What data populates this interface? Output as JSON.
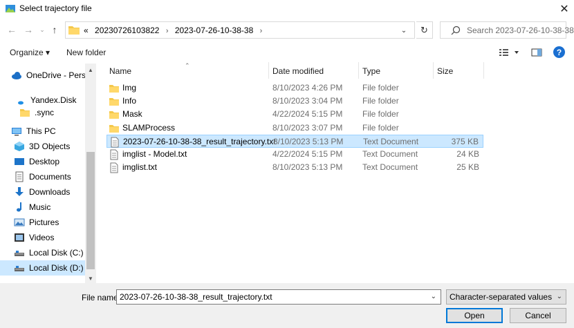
{
  "window": {
    "title": "Select trajectory file",
    "close_label": "✕"
  },
  "address": {
    "overflow": "«",
    "crumbs": [
      "20230726103822",
      "2023-07-26-10-38-38"
    ]
  },
  "search": {
    "placeholder": "Search 2023-07-26-10-38-38"
  },
  "toolbar": {
    "organize_label": "Organize ▾",
    "new_folder_label": "New folder",
    "help_label": "?"
  },
  "nav": {
    "items": [
      {
        "label": "OneDrive - Person",
        "icon": "cloud-icon"
      },
      {
        "label": "Yandex.Disk",
        "icon": "yandex-disk-icon"
      },
      {
        "label": ".sync",
        "icon": "folder-icon"
      },
      {
        "label": "This PC",
        "icon": "computer-icon"
      },
      {
        "label": "3D Objects",
        "icon": "3d-objects-icon"
      },
      {
        "label": "Desktop",
        "icon": "desktop-icon"
      },
      {
        "label": "Documents",
        "icon": "documents-icon"
      },
      {
        "label": "Downloads",
        "icon": "downloads-icon"
      },
      {
        "label": "Music",
        "icon": "music-icon"
      },
      {
        "label": "Pictures",
        "icon": "pictures-icon"
      },
      {
        "label": "Videos",
        "icon": "videos-icon"
      },
      {
        "label": "Local Disk (C:)",
        "icon": "local-disk-icon"
      },
      {
        "label": "Local Disk (D:)",
        "icon": "local-disk-icon",
        "selected": true
      }
    ]
  },
  "columns": {
    "name": "Name",
    "date": "Date modified",
    "type": "Type",
    "size": "Size"
  },
  "files": [
    {
      "name": "Img",
      "date": "8/10/2023 4:26 PM",
      "type": "File folder",
      "size": "",
      "icon": "folder-icon"
    },
    {
      "name": "Info",
      "date": "8/10/2023 3:04 PM",
      "type": "File folder",
      "size": "",
      "icon": "folder-icon"
    },
    {
      "name": "Mask",
      "date": "4/22/2024 5:15 PM",
      "type": "File folder",
      "size": "",
      "icon": "folder-icon"
    },
    {
      "name": "SLAMProcess",
      "date": "8/10/2023 3:07 PM",
      "type": "File folder",
      "size": "",
      "icon": "folder-icon"
    },
    {
      "name": "2023-07-26-10-38-38_result_trajectory.txt",
      "date": "8/10/2023 5:13 PM",
      "type": "Text Document",
      "size": "375 KB",
      "icon": "text-file-icon",
      "selected": true
    },
    {
      "name": "imglist - Model.txt",
      "date": "4/22/2024 5:15 PM",
      "type": "Text Document",
      "size": "24 KB",
      "icon": "text-file-icon"
    },
    {
      "name": "imglist.txt",
      "date": "8/10/2023 5:13 PM",
      "type": "Text Document",
      "size": "25 KB",
      "icon": "text-file-icon"
    }
  ],
  "footer": {
    "file_name_label": "File name:",
    "file_name_value": "2023-07-26-10-38-38_result_trajectory.txt",
    "filter_value": "Character-separated values (*.t",
    "open_label": "Open",
    "cancel_label": "Cancel"
  },
  "colors": {
    "accent": "#0078d7",
    "selection": "#cce8ff",
    "folder": "#f4c84a"
  }
}
